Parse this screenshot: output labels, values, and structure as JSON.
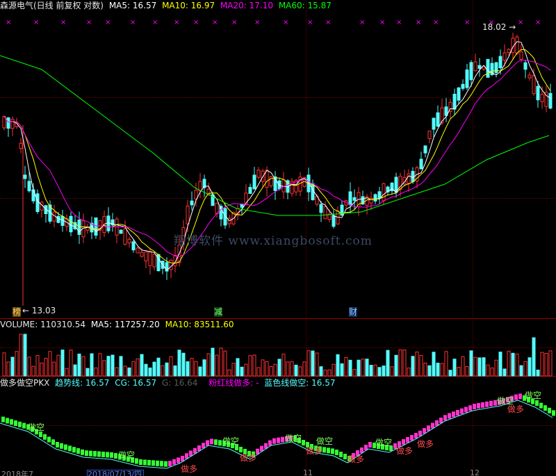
{
  "price_panel": {
    "stock_name": "森源电气(日线 前复权 对数)",
    "ma5_label": "MA5: 16.57",
    "ma10_label": "MA10: 16.97",
    "ma20_label": "MA20: 17.10",
    "ma60_label": "MA60: 15.87",
    "high_marker": "18.02",
    "low_marker": "13.03",
    "tags": [
      "榜",
      "减",
      "财"
    ],
    "colors": {
      "ma5": "#ffffff",
      "ma10": "#ffff00",
      "ma20": "#ff00ff",
      "ma60": "#00ff00",
      "up": "#ff3232",
      "down": "#54fcfc"
    }
  },
  "watermark": "翔博软件 www.xiangbosoft.com",
  "volume_panel": {
    "volume_label": "VOLUME: 110310.54",
    "ma5_label": "MA5: 117257.20",
    "ma10_label": "MA10: 83511.60"
  },
  "indicator_panel": {
    "name": "做多做空PKX",
    "trend_label": "趋势线: 16.57",
    "cg_label": "CG: 16.57",
    "g_label": "G: 16.64",
    "pink_label": "粉红线做多: -",
    "blue_label": "蓝色线做空: 16.57",
    "signal_short": "做空",
    "signal_long": "做多"
  },
  "axis": {
    "date_left": "2018年7",
    "date_selected": "2018/07/13/四",
    "tick_11": "11",
    "tick_12": "12"
  }
}
